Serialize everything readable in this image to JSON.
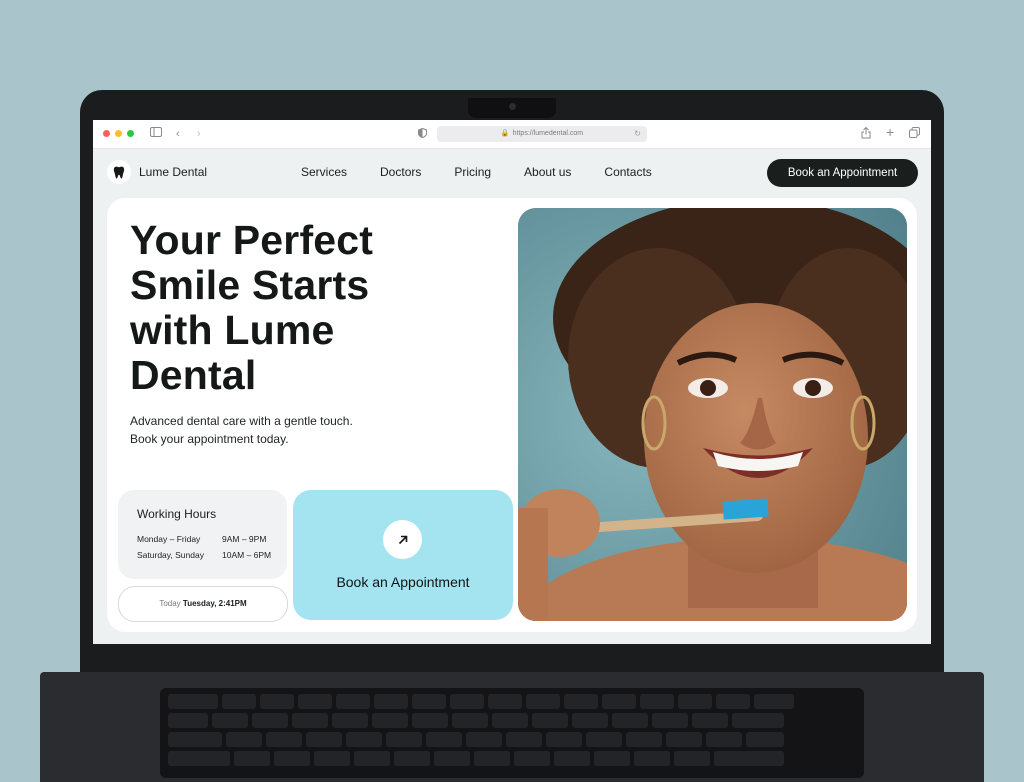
{
  "browser": {
    "url": "https://lumedental.com"
  },
  "site": {
    "brand": "Lume Dental",
    "nav": [
      "Services",
      "Doctors",
      "Pricing",
      "About us",
      "Contacts"
    ],
    "cta": "Book an Appointment"
  },
  "hero": {
    "title_lines": [
      "Your Perfect",
      "Smile Starts",
      "with Lume",
      "Dental"
    ],
    "subtitle_lines": [
      "Advanced dental care with a gentle touch.",
      "Book your appointment today."
    ]
  },
  "hours": {
    "title": "Working Hours",
    "rows": [
      {
        "days": "Monday – Friday",
        "time": "9AM – 9PM"
      },
      {
        "days": "Saturday, Sunday",
        "time": "10AM – 6PM"
      }
    ]
  },
  "today": {
    "label": "Today",
    "value": "Tuesday, 2:41PM"
  },
  "book_card": {
    "label": "Book an Appointment"
  },
  "colors": {
    "background": "#a9c4cb",
    "accent": "#a4e4f1",
    "dark": "#1a1f1e"
  }
}
